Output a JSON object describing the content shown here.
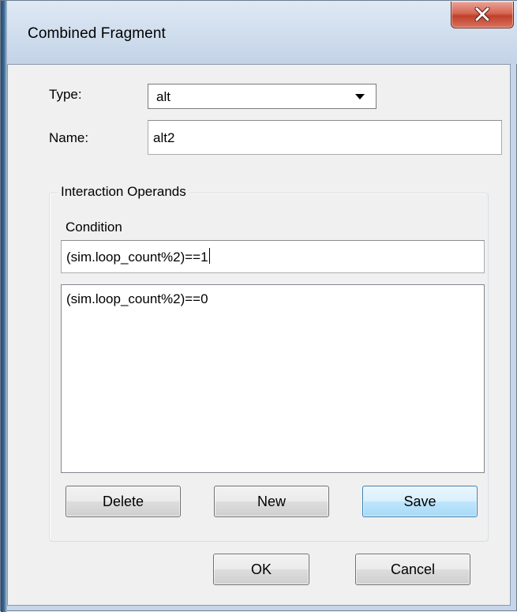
{
  "window": {
    "title": "Combined Fragment",
    "close_glyph": "X"
  },
  "form": {
    "type_label": "Type:",
    "type_value": "alt",
    "name_label": "Name:",
    "name_value": "alt2"
  },
  "operands": {
    "group_title": "Interaction Operands",
    "condition_label": "Condition",
    "condition_value": "(sim.loop_count%2)==1",
    "list_items": [
      "(sim.loop_count%2)==0"
    ],
    "delete_label": "Delete",
    "new_label": "New",
    "save_label": "Save"
  },
  "footer": {
    "ok_label": "OK",
    "cancel_label": "Cancel"
  },
  "colors": {
    "close_button": "#c7503b",
    "focused_button": "#3c7fb1",
    "title_bar": "#cfdded",
    "dialog_face": "#f0f0f0"
  }
}
